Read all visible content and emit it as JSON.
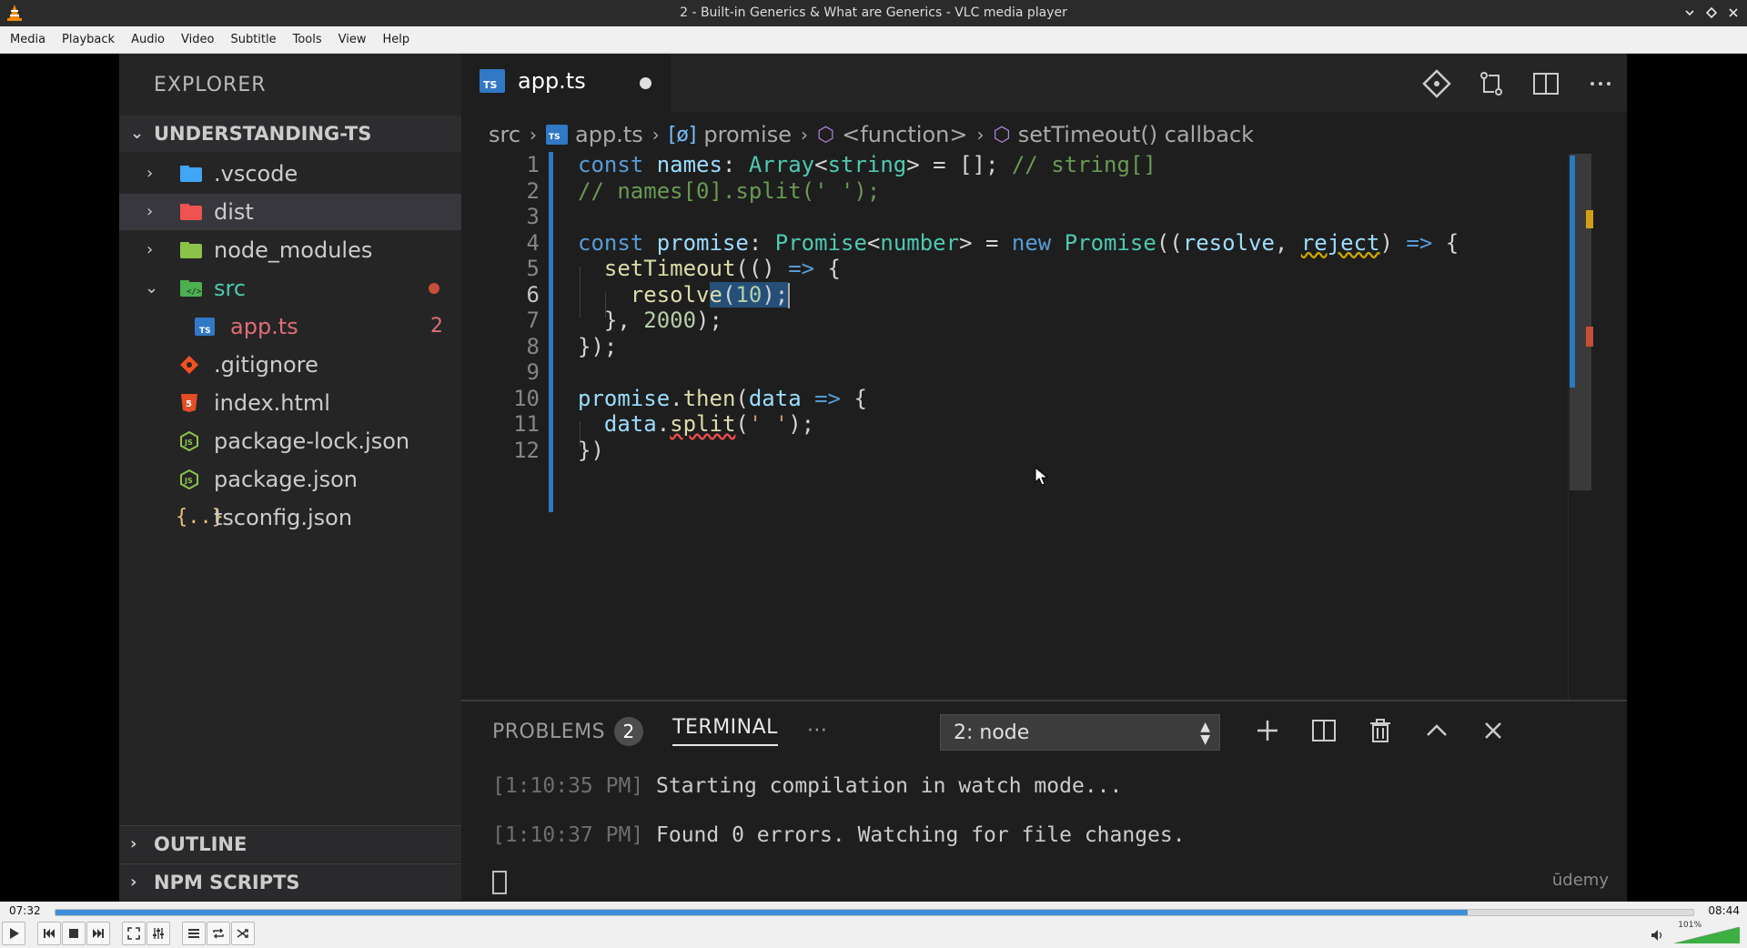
{
  "window": {
    "title": "2 - Built-in Generics & What are Generics - VLC media player"
  },
  "menu": [
    "Media",
    "Playback",
    "Audio",
    "Video",
    "Subtitle",
    "Tools",
    "View",
    "Help"
  ],
  "player": {
    "elapsed": "07:32",
    "total": "08:44",
    "progress_fraction": 0.862,
    "volume_label": "101%",
    "accent": "#3f8fd8"
  },
  "explorer": {
    "title": "EXPLORER",
    "project": "UNDERSTANDING-TS",
    "items": [
      {
        "name": ".vscode",
        "icon": "vscode-folder-icon"
      },
      {
        "name": "dist",
        "icon": "dist-folder-icon"
      },
      {
        "name": "node_modules",
        "icon": "node-folder-icon"
      },
      {
        "name": "src",
        "icon": "src-folder-icon"
      },
      {
        "name": "app.ts",
        "icon": "typescript-file-icon",
        "badge": "2"
      },
      {
        "name": ".gitignore",
        "icon": "git-file-icon"
      },
      {
        "name": "index.html",
        "icon": "html-file-icon"
      },
      {
        "name": "package-lock.json",
        "icon": "json-file-icon"
      },
      {
        "name": "package.json",
        "icon": "json-file-icon"
      },
      {
        "name": "tsconfig.json",
        "icon": "tsconfig-file-icon"
      }
    ],
    "sections": [
      "OUTLINE",
      "NPM SCRIPTS"
    ]
  },
  "editor": {
    "tab": {
      "name": "app.ts",
      "icon_text": "TS"
    },
    "breadcrumb": [
      "src",
      "app.ts",
      "promise",
      "<function>",
      "setTimeout() callback"
    ],
    "line_numbers": [
      "1",
      "2",
      "3",
      "4",
      "5",
      "6",
      "7",
      "8",
      "9",
      "10",
      "11",
      "12"
    ]
  },
  "panel": {
    "problems_label": "PROBLEMS",
    "problems_count": "2",
    "terminal_label": "TERMINAL",
    "more": "···",
    "terminal_select": "2: node",
    "lines": [
      {
        "ts": "[1:10:35 PM]",
        "msg": " Starting compilation in watch mode..."
      },
      {
        "ts": "[1:10:37 PM]",
        "msg": " Found 0 errors. Watching for file changes."
      }
    ],
    "watermark": "ūdemy"
  }
}
